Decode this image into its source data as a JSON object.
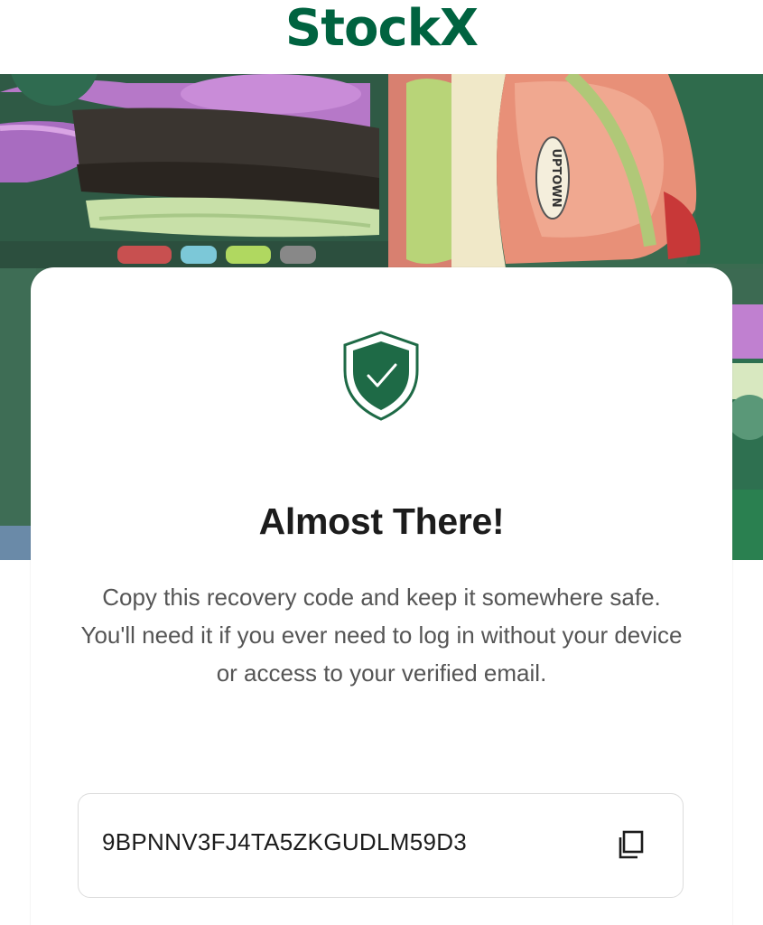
{
  "brand": {
    "logo_text": "StockX",
    "color": "#006340"
  },
  "hero": {
    "image_description": "sneaker-collage-background",
    "shoe_label_text": "UPTOWN"
  },
  "card": {
    "icon": "shield-check-icon",
    "title": "Almost There!",
    "description": "Copy this recovery code and keep it somewhere safe. You'll need it if you ever need to log in without your device or access to your verified email.",
    "recovery_code": "9BPNNV3FJ4TA5ZKGUDLM59D3",
    "copy_icon": "copy-icon"
  },
  "colors": {
    "accent": "#006340",
    "title_text": "#1c1c1c",
    "body_text": "#555555",
    "border": "#dcdcdc"
  }
}
